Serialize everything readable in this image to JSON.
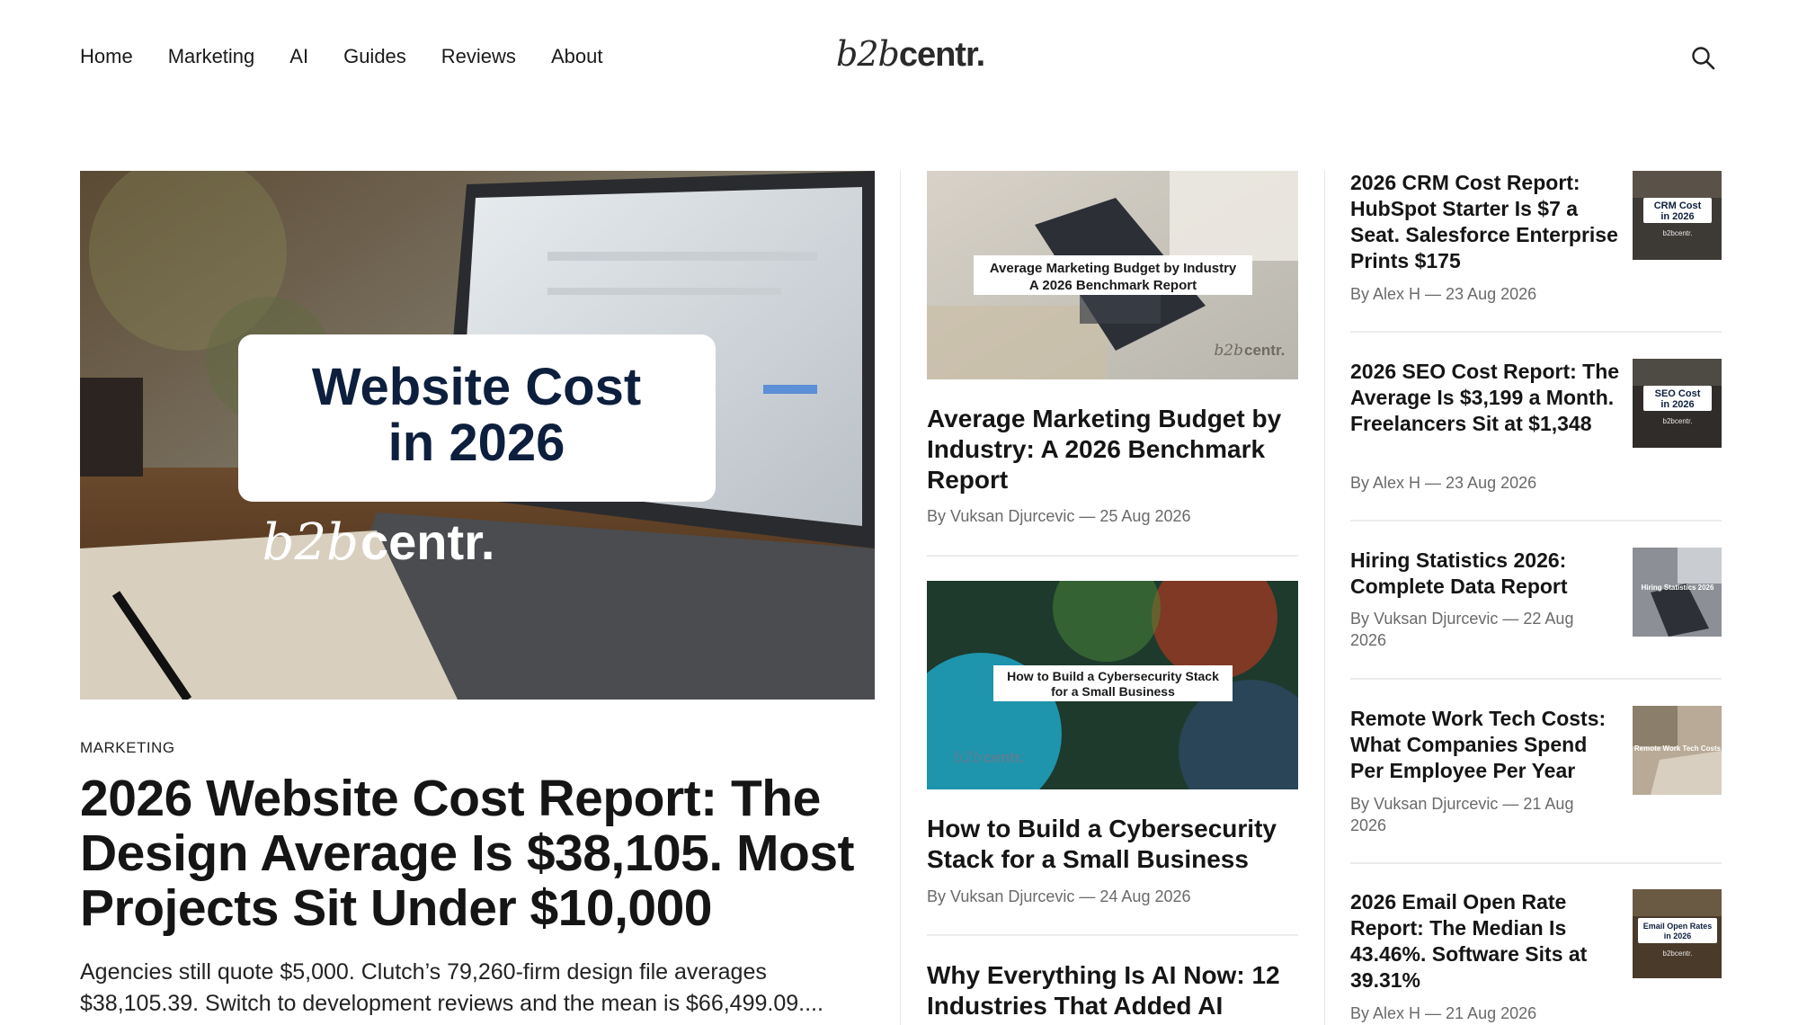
{
  "nav": {
    "items": [
      "Home",
      "Marketing",
      "AI",
      "Guides",
      "Reviews",
      "About"
    ],
    "logo_italic": "b2b",
    "logo_bold": "centr."
  },
  "hero": {
    "image_title_line1": "Website Cost",
    "image_title_line2": "in 2026",
    "image_logo_italic": "b2b",
    "image_logo_bold": "centr.",
    "category": "MARKETING",
    "title": "2026 Website Cost Report: The Design Average Is $38,105. Most Projects Sit Under $10,000",
    "excerpt": "Agencies still quote $5,000. Clutch’s 79,260-firm design file averages $38,105.39. Switch to development reviews and the mean is $66,499.09...."
  },
  "middle": [
    {
      "image_caption_line1": "Average Marketing Budget by Industry",
      "image_caption_line2": "A 2026 Benchmark Report",
      "image_watermark_italic": "b2b",
      "image_watermark_bold": "centr.",
      "title": "Average Marketing Budget by Industry: A 2026 Benchmark Report",
      "meta": "By Vuksan Djurcevic — 25 Aug 2026"
    },
    {
      "image_caption_line1": "How to Build a Cybersecurity Stack",
      "image_caption_line2": "for a Small Business",
      "image_watermark_italic": "b2b",
      "image_watermark_bold": "centr.",
      "title": "How to Build a Cybersecurity Stack for a Small Business",
      "meta": "By Vuksan Djurcevic — 24 Aug 2026"
    },
    {
      "title": "Why Everything Is AI Now: 12 Industries That Added AI"
    }
  ],
  "right": [
    {
      "title": "2026 CRM Cost Report: HubSpot Starter Is $7 a Seat. Salesforce Enterprise Prints $175",
      "meta": "By Alex H — 23 Aug 2026",
      "thumb_line1": "CRM Cost",
      "thumb_line2": "in 2026",
      "thumb_logo": "b2bcentr."
    },
    {
      "title": "2026 SEO Cost Report: The Average Is $3,199 a Month. Freelancers Sit at $1,348",
      "meta": "By Alex H — 23 Aug 2026",
      "thumb_line1": "SEO Cost",
      "thumb_line2": "in 2026",
      "thumb_logo": "b2bcentr."
    },
    {
      "title": "Hiring Statistics 2026: Complete Data Report",
      "meta": "By Vuksan Djurcevic — 22 Aug 2026",
      "thumb_line1": "Hiring Statistics 2026"
    },
    {
      "title": "Remote Work Tech Costs: What Companies Spend Per Employee Per Year",
      "meta": "By Vuksan Djurcevic — 21 Aug 2026",
      "thumb_line1": "Remote Work Tech Costs"
    },
    {
      "title": "2026 Email Open Rate Report: The Median Is 43.46%. Software Sits at 39.31%",
      "meta": "By Alex H — 21 Aug 2026",
      "thumb_line1": "Email Open Rates",
      "thumb_line2": "in 2026",
      "thumb_logo": "b2bcentr."
    }
  ]
}
